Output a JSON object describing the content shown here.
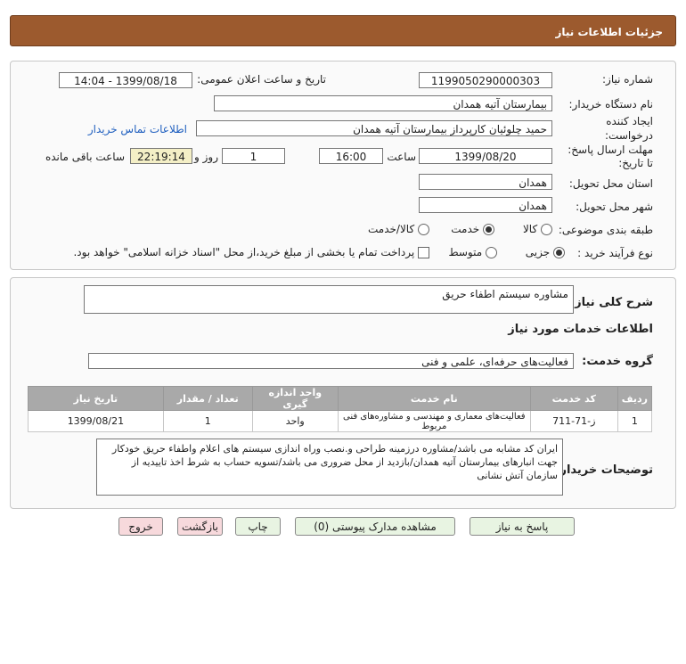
{
  "header": {
    "title": "جزئیات اطلاعات نیاز"
  },
  "form": {
    "need_number_label": "شماره نیاز:",
    "need_number": "1199050290000303",
    "announce_label": "تاریخ و ساعت اعلان عمومی:",
    "announce_value": "1399/08/18 - 14:04",
    "buyer_org_label": "نام دستگاه خریدار:",
    "buyer_org": "بیمارستان آتیه همدان",
    "requester_label": "ایجاد کننده درخواست:",
    "requester": "حمید چلوئیان  کارپرداز بیمارستان آتیه همدان",
    "contact_link": "اطلاعات تماس خریدار",
    "deadline_label": "مهلت ارسال پاسخ: تا تاریخ:",
    "deadline_date": "1399/08/20",
    "time_label": "ساعت",
    "deadline_time": "16:00",
    "days_value": "1",
    "days_label": "روز و",
    "remaining_time": "22:19:14",
    "remaining_label": "ساعت باقی مانده",
    "province_label": "استان محل تحویل:",
    "province": "همدان",
    "city_label": "شهر محل تحویل:",
    "city": "همدان",
    "category_label": "طبقه بندی موضوعی:",
    "category_options": [
      "کالا",
      "خدمت",
      "کالا/خدمت"
    ],
    "category_selected": "خدمت",
    "process_label": "نوع فرآیند خرید :",
    "process_options": [
      "جزیی",
      "متوسط"
    ],
    "process_selected": "جزیی",
    "treasury_note": "پرداخت تمام یا بخشی از مبلغ خرید،از محل \"اسناد خزانه اسلامی\" خواهد بود."
  },
  "details": {
    "summary_label": "شرح کلی نیاز:",
    "summary_value": "مشاوره سیستم اطفاء حریق",
    "services_heading": "اطلاعات خدمات مورد نیاز",
    "service_group_label": "گروه خدمت:",
    "service_group_value": "فعالیت‌های حرفه‌ای، علمی و فنی",
    "table": {
      "headers": [
        "ردیف",
        "کد خدمت",
        "نام خدمت",
        "واحد اندازه گیری",
        "تعداد / مقدار",
        "تاریخ نیاز"
      ],
      "rows": [
        [
          "1",
          "ز-71-711",
          "فعالیت‌های معماری و مهندسی و مشاوره‌های فنی مربوط",
          "واحد",
          "1",
          "1399/08/21"
        ]
      ]
    },
    "buyer_notes_label": "توضیحات خریدار:",
    "buyer_notes": "ایران کد مشابه می باشد/مشاوره درزمینه طراحی و.نصب وراه اندازی سیستم های اعلام واطفاء حریق خودکار جهت انبارهای بیمارستان آتیه همدان/بازدید از محل ضروری می باشد/تسویه حساب به شرط اخذ تاییدیه از سازمان آتش نشانی"
  },
  "buttons": {
    "reply": "پاسخ به نیاز",
    "attachments": "مشاهده مدارک پیوستی (0)",
    "print": "چاپ",
    "back": "بازگشت",
    "exit": "خروج"
  },
  "colors": {
    "header_bg": "#9c5a2e",
    "table_header_bg": "#a9a9a9",
    "link": "#1f5fbf",
    "button_green": "#e8f4e2",
    "button_pink": "#f7d9dc"
  }
}
